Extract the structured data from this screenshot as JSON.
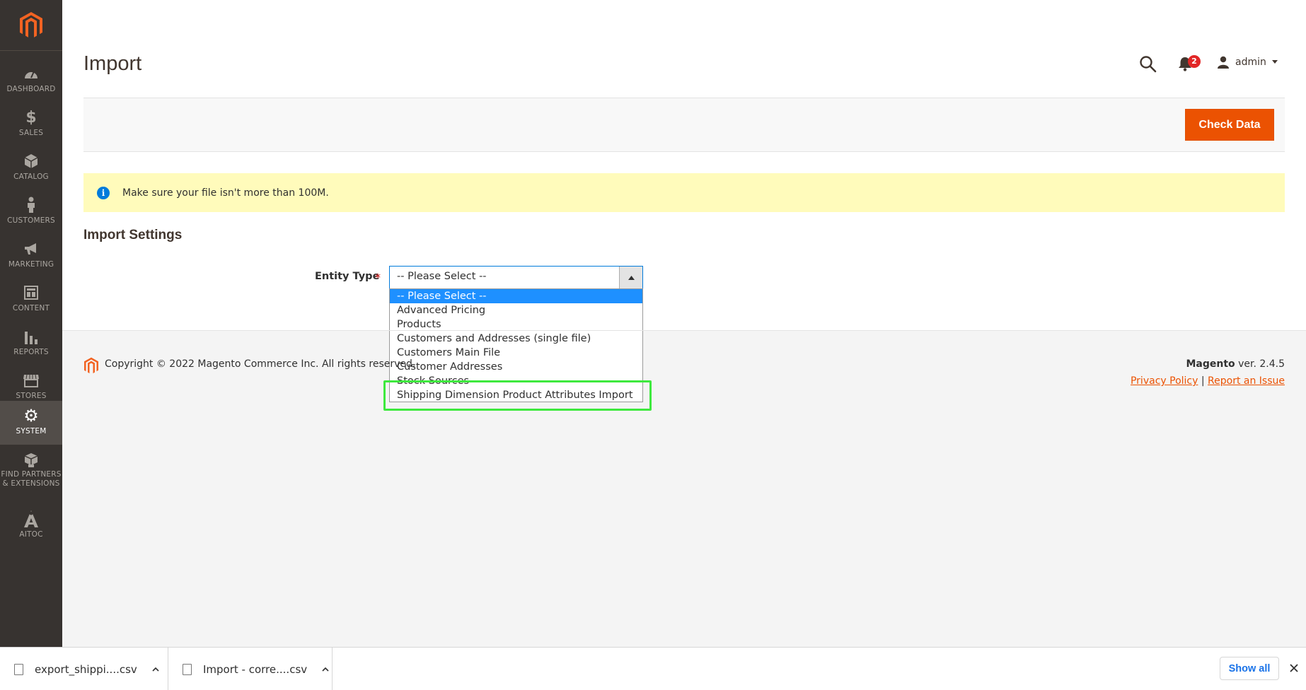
{
  "page": {
    "title": "Import"
  },
  "sidebar": {
    "items": [
      {
        "label": "DASHBOARD",
        "icon": "dashboard-icon"
      },
      {
        "label": "SALES",
        "icon": "dollar-icon"
      },
      {
        "label": "CATALOG",
        "icon": "cube-icon"
      },
      {
        "label": "CUSTOMERS",
        "icon": "person-icon"
      },
      {
        "label": "MARKETING",
        "icon": "megaphone-icon"
      },
      {
        "label": "CONTENT",
        "icon": "layout-icon"
      },
      {
        "label": "REPORTS",
        "icon": "bar-chart-icon"
      },
      {
        "label": "STORES",
        "icon": "storefront-icon"
      },
      {
        "label": "SYSTEM",
        "icon": "gear-icon",
        "active": true
      },
      {
        "label": "FIND PARTNERS & EXTENSIONS",
        "label_line1": "FIND PARTNERS",
        "label_line2": "& EXTENSIONS",
        "icon": "boxes-icon"
      },
      {
        "label": "AITOC",
        "icon": "aitoc-icon"
      }
    ]
  },
  "header": {
    "notifications_count": "2",
    "user_name": "admin"
  },
  "actions": {
    "check_data": "Check Data"
  },
  "notice": {
    "text": "Make sure your file isn't more than 100M."
  },
  "import_settings": {
    "section_title": "Import Settings",
    "entity_type_label": "Entity Type",
    "required_mark": "*",
    "selected_value": "-- Please Select --",
    "options": [
      "-- Please Select --",
      "Advanced Pricing",
      "Products",
      "Customers and Addresses (single file)",
      "Customers Main File",
      "Customer Addresses",
      "Stock Sources",
      "Shipping Dimension Product Attributes Import"
    ]
  },
  "footer": {
    "copyright": "Copyright © 2022 Magento Commerce Inc. All rights reserved.",
    "brand": "Magento",
    "version": " ver. 2.4.5",
    "privacy_policy": "Privacy Policy",
    "separator": "|",
    "report_issue": "Report an Issue"
  },
  "downloads": {
    "items": [
      {
        "name": "export_shippi....csv"
      },
      {
        "name": "Import - corre....csv"
      }
    ],
    "show_all": "Show all"
  },
  "colors": {
    "sidebar_bg": "#373330",
    "accent": "#eb5202",
    "selection": "#1e90ff",
    "highlight": "#3ee93e"
  }
}
